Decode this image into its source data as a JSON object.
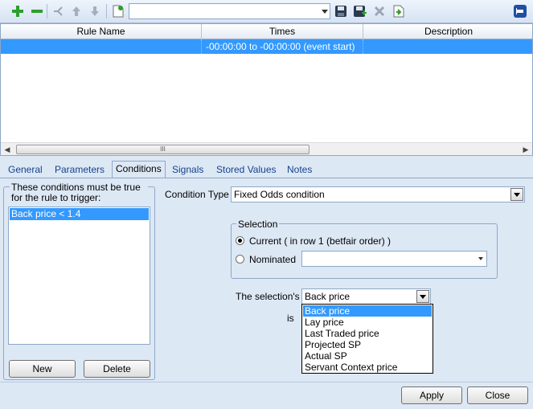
{
  "toolbar": {
    "buttons": [
      "add-icon",
      "remove-icon",
      "branch-icon",
      "move-up-icon",
      "move-down-icon",
      "new-document-icon"
    ],
    "combo_value": "",
    "right_buttons": [
      "save-icon",
      "save-as-icon",
      "delete-icon",
      "import-icon"
    ],
    "pin_icon": "pin-icon"
  },
  "grid": {
    "columns": [
      "Rule Name",
      "Times",
      "Description"
    ],
    "rows": [
      {
        "rule_name": "",
        "times": "-00:00:00 to -00:00:00 (event start)",
        "description": ""
      }
    ],
    "scroll_grip": "III"
  },
  "tabs": [
    "General",
    "Parameters",
    "Conditions",
    "Signals",
    "Stored Values",
    "Notes"
  ],
  "conditions_panel": {
    "group_label": "These conditions must be true for the rule to trigger:",
    "items": [
      "Back price < 1.4"
    ],
    "new_label": "New",
    "delete_label": "Delete"
  },
  "condition": {
    "type_label": "Condition Type",
    "type_value": "Fixed Odds condition",
    "selection_group_label": "Selection",
    "current_label": "Current ( in row 1 (betfair order) )",
    "nominated_label": "Nominated",
    "nominated_value": "",
    "selections_label": "The selection's",
    "selections_value": "Back price",
    "is_label": "is",
    "options": [
      "Back price",
      "Lay price",
      "Last Traded price",
      "Projected SP",
      "Actual SP",
      "Servant Context price"
    ]
  },
  "footer": {
    "apply_label": "Apply",
    "close_label": "Close"
  },
  "colors": {
    "selection_blue": "#3399ff",
    "panel_bg": "#dde8f5",
    "green_add": "#2e9e2e"
  }
}
